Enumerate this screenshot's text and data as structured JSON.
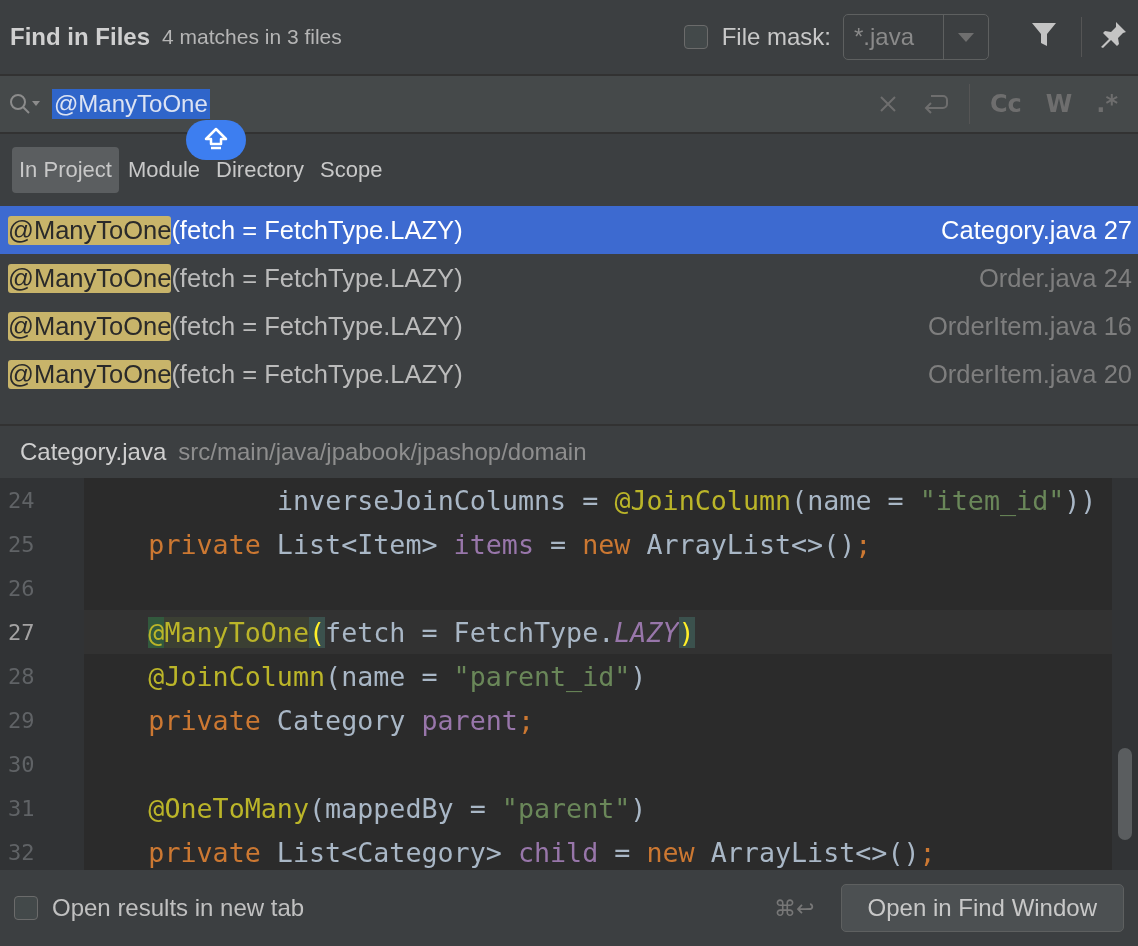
{
  "header": {
    "title": "Find in Files",
    "summary": "4 matches in 3 files",
    "file_mask": {
      "label": "File mask:",
      "checked": false,
      "value": "*.java"
    }
  },
  "search": {
    "query": "@ManyToOne",
    "options": [
      {
        "label": "Cc",
        "on": false
      },
      {
        "label": "W",
        "on": false
      },
      {
        "label": ".*",
        "on": false
      }
    ]
  },
  "scopes": [
    {
      "label": "In Project",
      "selected": true
    },
    {
      "label": "Module",
      "selected": false
    },
    {
      "label": "Directory",
      "selected": false
    },
    {
      "label": "Scope",
      "selected": false
    }
  ],
  "results": [
    {
      "match": "@ManyToOne",
      "context": "(fetch = FetchType.LAZY)",
      "location": "Category.java 27",
      "selected": true
    },
    {
      "match": "@ManyToOne",
      "context": "(fetch = FetchType.LAZY)",
      "location": "Order.java 24",
      "selected": false
    },
    {
      "match": "@ManyToOne",
      "context": "(fetch = FetchType.LAZY)",
      "location": "OrderItem.java 16",
      "selected": false
    },
    {
      "match": "@ManyToOne",
      "context": "(fetch = FetchType.LAZY)",
      "location": "OrderItem.java 20",
      "selected": false
    }
  ],
  "preview": {
    "file": "Category.java",
    "path": "src/main/java/jpabook/jpashop/domain",
    "lines": [
      {
        "number": "24",
        "current": false,
        "kind": "continuation",
        "tokens": [
          {
            "kind": "plain",
            "text": "inverseJoinColumns = "
          },
          {
            "kind": "annotation",
            "text": "@JoinColumn"
          },
          {
            "kind": "plain",
            "text": "(name = "
          },
          {
            "kind": "string",
            "text": "\"item_id\""
          },
          {
            "kind": "plain",
            "text": "))"
          }
        ]
      },
      {
        "number": "25",
        "current": false,
        "kind": "member",
        "tokens": [
          {
            "kind": "keyword",
            "text": "private"
          },
          {
            "kind": "plain",
            "text": " List<Item> "
          },
          {
            "kind": "field",
            "text": "items"
          },
          {
            "kind": "plain",
            "text": " = "
          },
          {
            "kind": "keyword",
            "text": "new"
          },
          {
            "kind": "plain",
            "text": " ArrayList<>()"
          },
          {
            "kind": "keyword",
            "text": ";"
          }
        ]
      },
      {
        "number": "26",
        "current": false
      },
      {
        "number": "27",
        "current": true,
        "kind": "member",
        "tokens": [
          {
            "kind": "at-match",
            "text": "@"
          },
          {
            "kind": "annotation-match",
            "text": "ManyToOne"
          },
          {
            "kind": "brace-match",
            "text": "("
          },
          {
            "kind": "plain",
            "text": "fetch = FetchType."
          },
          {
            "kind": "constant",
            "text": "LAZY"
          },
          {
            "kind": "brace-match",
            "text": ")"
          }
        ]
      },
      {
        "number": "28",
        "current": false,
        "kind": "member",
        "tokens": [
          {
            "kind": "annotation",
            "text": "@JoinColumn"
          },
          {
            "kind": "plain",
            "text": "(name = "
          },
          {
            "kind": "string",
            "text": "\"parent_id\""
          },
          {
            "kind": "plain",
            "text": ")"
          }
        ]
      },
      {
        "number": "29",
        "current": false,
        "kind": "member",
        "tokens": [
          {
            "kind": "keyword",
            "text": "private"
          },
          {
            "kind": "plain",
            "text": " Category "
          },
          {
            "kind": "field",
            "text": "parent"
          },
          {
            "kind": "keyword",
            "text": ";"
          }
        ]
      },
      {
        "number": "30",
        "current": false
      },
      {
        "number": "31",
        "current": false,
        "kind": "member",
        "tokens": [
          {
            "kind": "annotation",
            "text": "@OneToMany"
          },
          {
            "kind": "plain",
            "text": "(mappedBy = "
          },
          {
            "kind": "string",
            "text": "\"parent\""
          },
          {
            "kind": "plain",
            "text": ")"
          }
        ]
      },
      {
        "number": "32",
        "current": false,
        "kind": "member",
        "tokens": [
          {
            "kind": "keyword",
            "text": "private"
          },
          {
            "kind": "plain",
            "text": " List<Category> "
          },
          {
            "kind": "field",
            "text": "child"
          },
          {
            "kind": "plain",
            "text": " = "
          },
          {
            "kind": "keyword",
            "text": "new"
          },
          {
            "kind": "plain",
            "text": " ArrayList<>()"
          },
          {
            "kind": "keyword",
            "text": ";"
          }
        ]
      }
    ]
  },
  "footer": {
    "new_tab": {
      "label": "Open results in new tab",
      "checked": false
    },
    "shortcut": "⌘↩",
    "button": "Open in Find Window"
  }
}
